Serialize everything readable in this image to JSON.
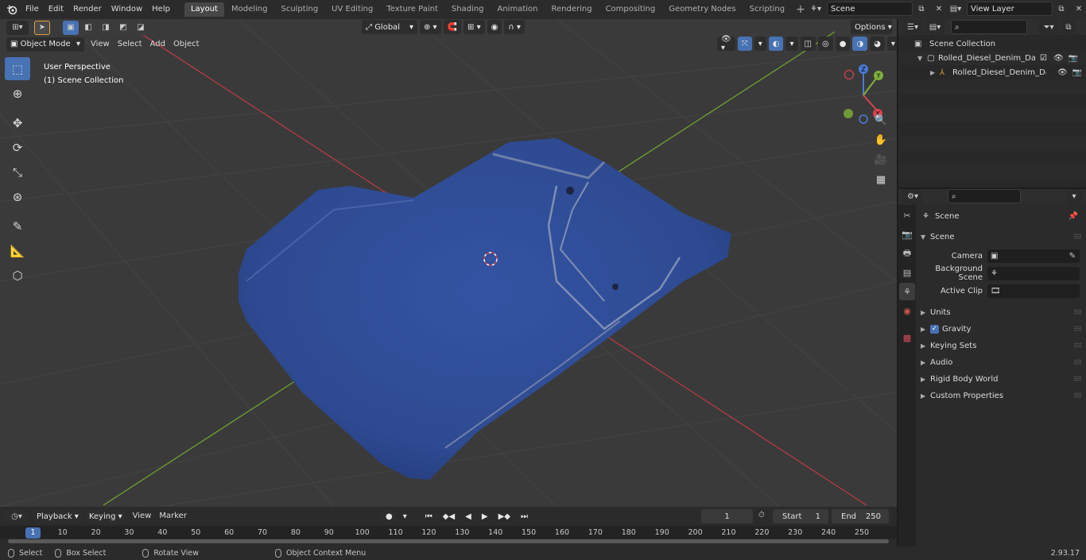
{
  "topbar": {
    "menus": [
      "File",
      "Edit",
      "Render",
      "Window",
      "Help"
    ],
    "workspaces": [
      "Layout",
      "Modeling",
      "Sculpting",
      "UV Editing",
      "Texture Paint",
      "Shading",
      "Animation",
      "Rendering",
      "Compositing",
      "Geometry Nodes",
      "Scripting"
    ],
    "active_workspace": "Layout",
    "scene_name": "Scene",
    "view_layer_name": "View Layer"
  },
  "viewport": {
    "mode": "Object Mode",
    "menus": [
      "View",
      "Select",
      "Add",
      "Object"
    ],
    "transform_orientation": "Global",
    "options_label": "Options",
    "overlay_line1": "User Perspective",
    "overlay_line2": "(1) Scene Collection",
    "gizmo": {
      "x": "X",
      "y": "Y",
      "z": "Z"
    },
    "object_color": "#2e4a91"
  },
  "outliner": {
    "root": "Scene Collection",
    "items": [
      {
        "label": "Rolled_Diesel_Denim_Dark_B",
        "level": 1
      },
      {
        "label": "Rolled_Diesel_Denim_Da",
        "level": 2
      }
    ]
  },
  "properties": {
    "context_title": "Scene",
    "panel_title": "Scene",
    "fields": [
      {
        "label": "Camera",
        "value": ""
      },
      {
        "label": "Background Scene",
        "value": ""
      },
      {
        "label": "Active Clip",
        "value": ""
      }
    ],
    "subpanels": [
      "Units",
      "Gravity",
      "Keying Sets",
      "Audio",
      "Rigid Body World",
      "Custom Properties"
    ],
    "gravity_checked": true
  },
  "timeline": {
    "menus": [
      "Playback",
      "Keying",
      "View",
      "Marker"
    ],
    "current_frame": "1",
    "start_label": "Start",
    "start_value": "1",
    "end_label": "End",
    "end_value": "250",
    "ticks": [
      "1",
      "10",
      "20",
      "30",
      "40",
      "50",
      "60",
      "70",
      "80",
      "90",
      "100",
      "110",
      "120",
      "130",
      "140",
      "150",
      "160",
      "170",
      "180",
      "190",
      "200",
      "210",
      "220",
      "230",
      "240",
      "250"
    ]
  },
  "statusbar": {
    "select": "Select",
    "box_select": "Box Select",
    "rotate_view": "Rotate View",
    "context_menu": "Object Context Menu",
    "version": "2.93.17"
  }
}
